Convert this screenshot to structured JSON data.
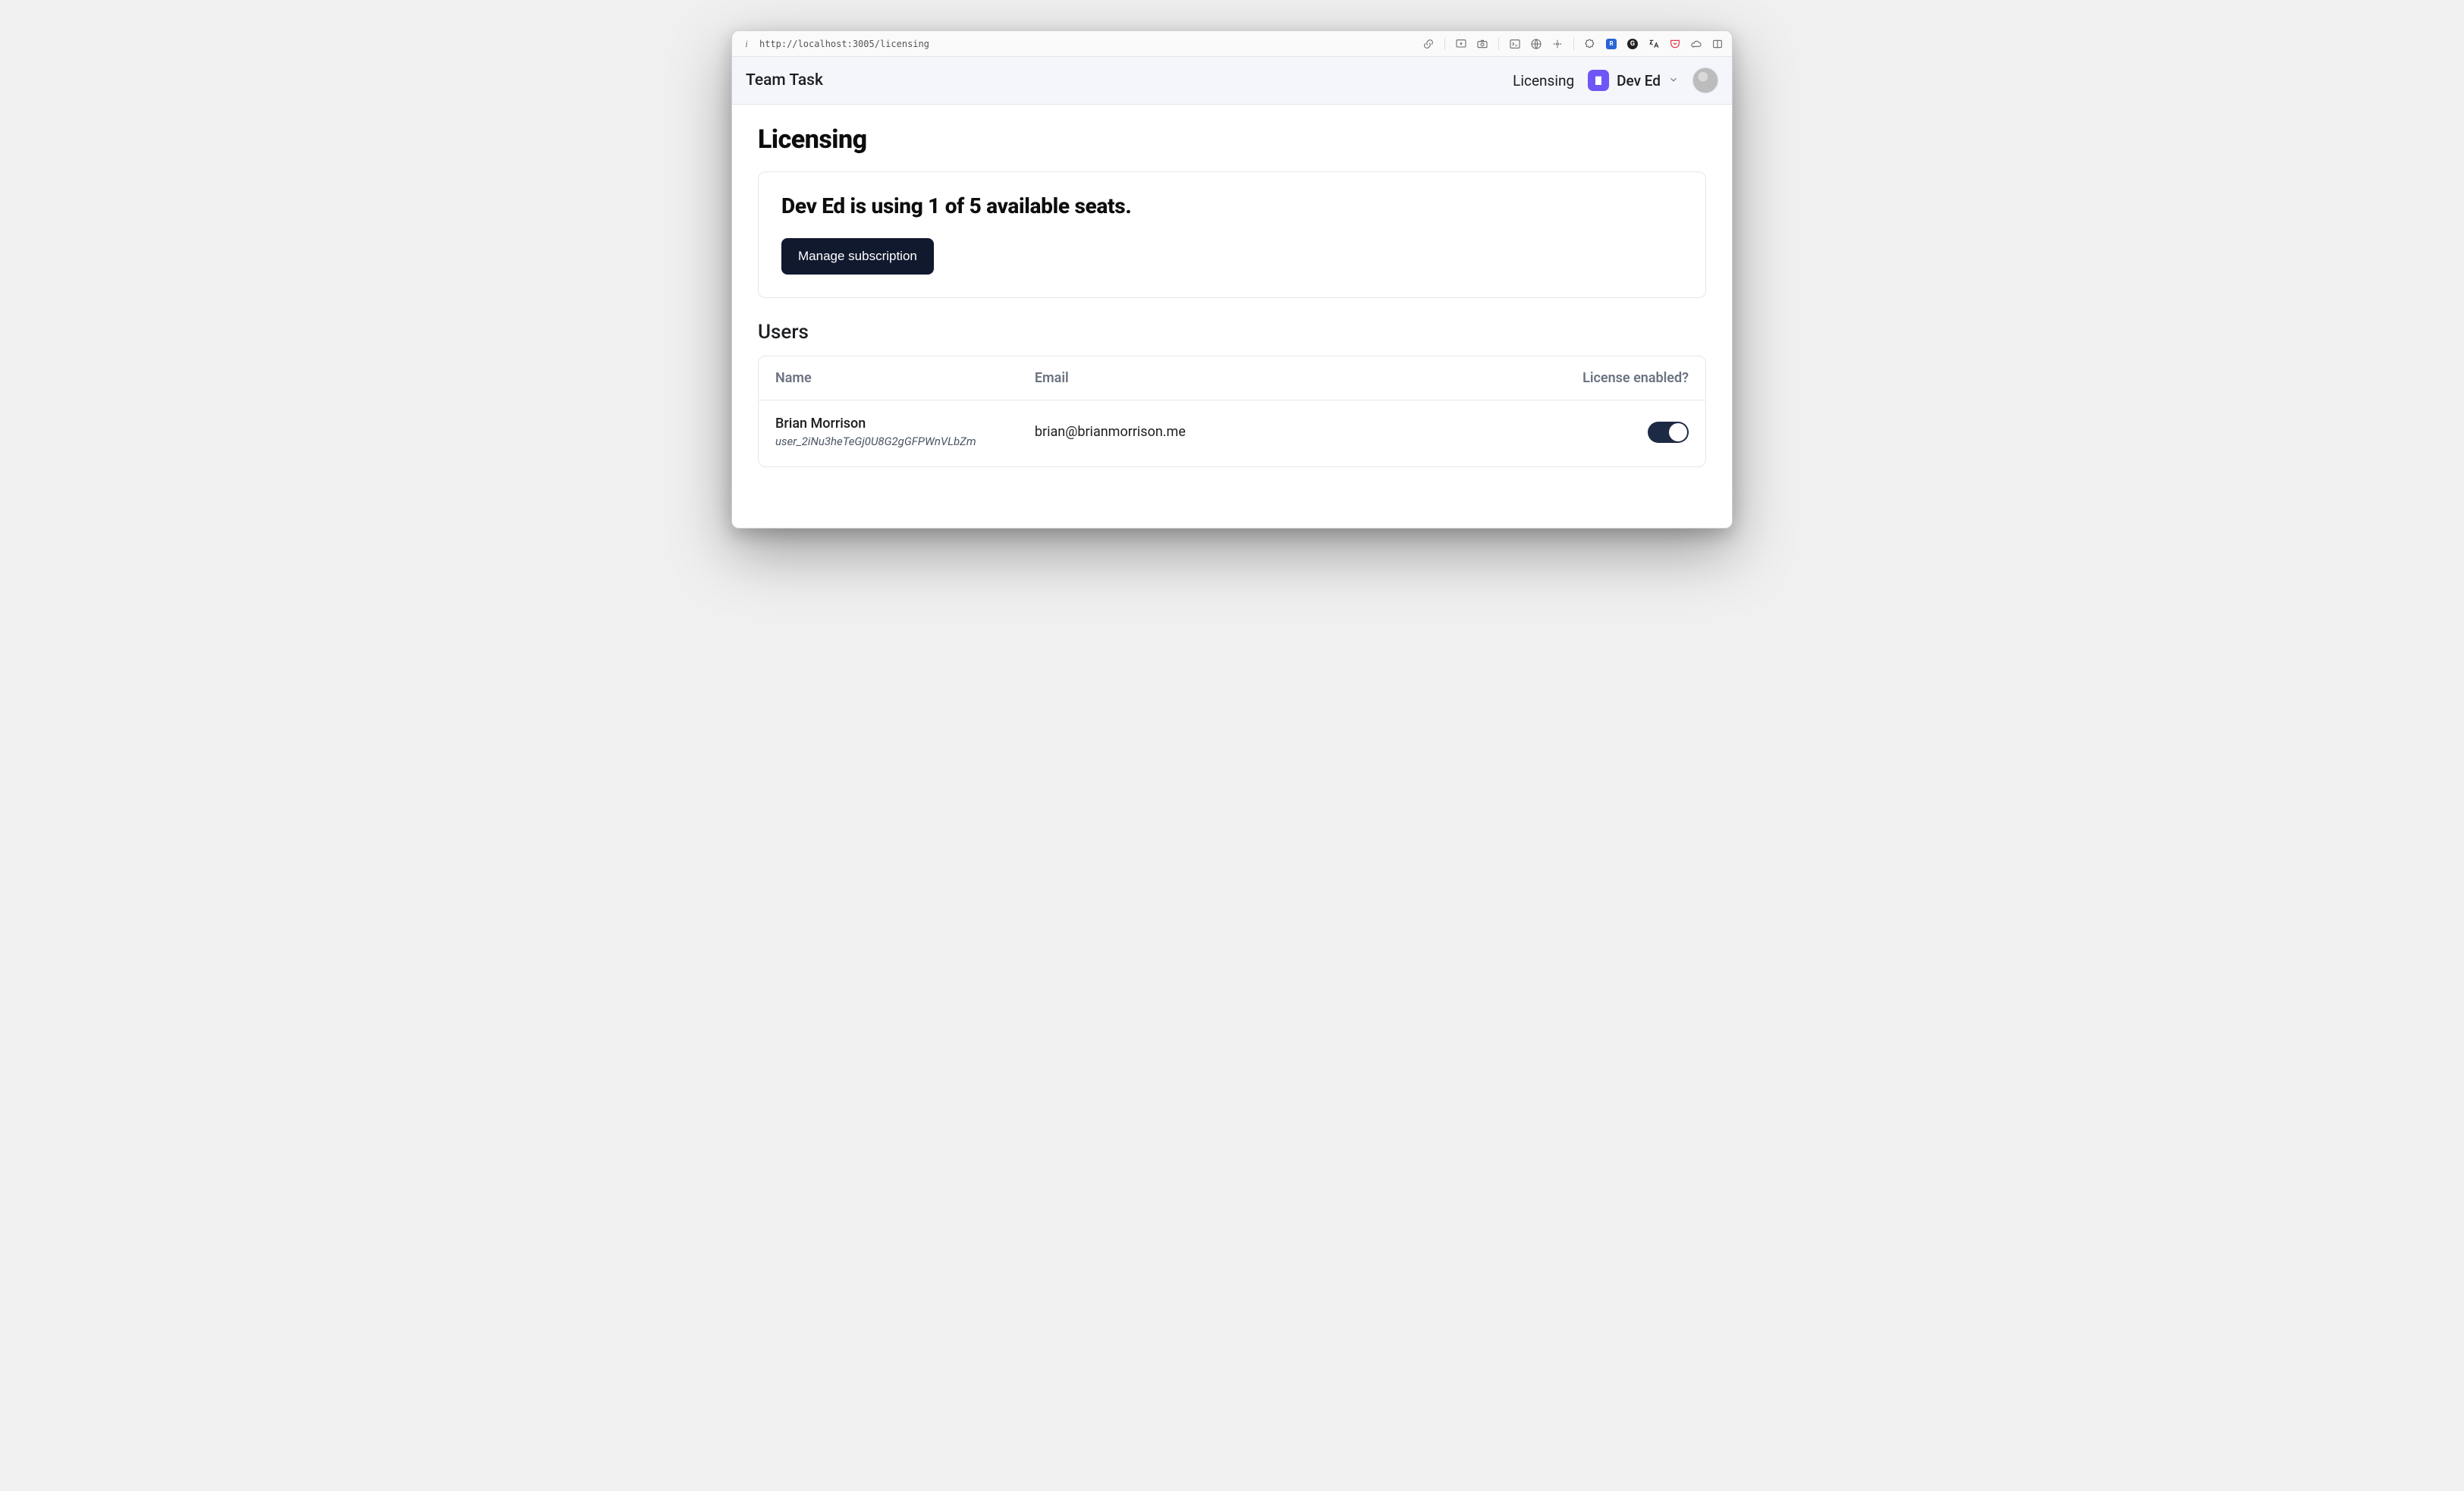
{
  "browser": {
    "url": "http://localhost:3005/licensing"
  },
  "header": {
    "app_title": "Team Task",
    "nav_licensing": "Licensing",
    "org_name": "Dev Ed"
  },
  "page": {
    "title": "Licensing",
    "seats_line": "Dev Ed is using 1 of 5 available seats.",
    "manage_button": "Manage subscription",
    "users_heading": "Users",
    "columns": {
      "name": "Name",
      "email": "Email",
      "license": "License enabled?"
    },
    "users": [
      {
        "name": "Brian Morrison",
        "id": "user_2iNu3heTeGj0U8G2gGFPWnVLbZm",
        "email": "brian@brianmorrison.me",
        "license_enabled": true
      }
    ]
  }
}
